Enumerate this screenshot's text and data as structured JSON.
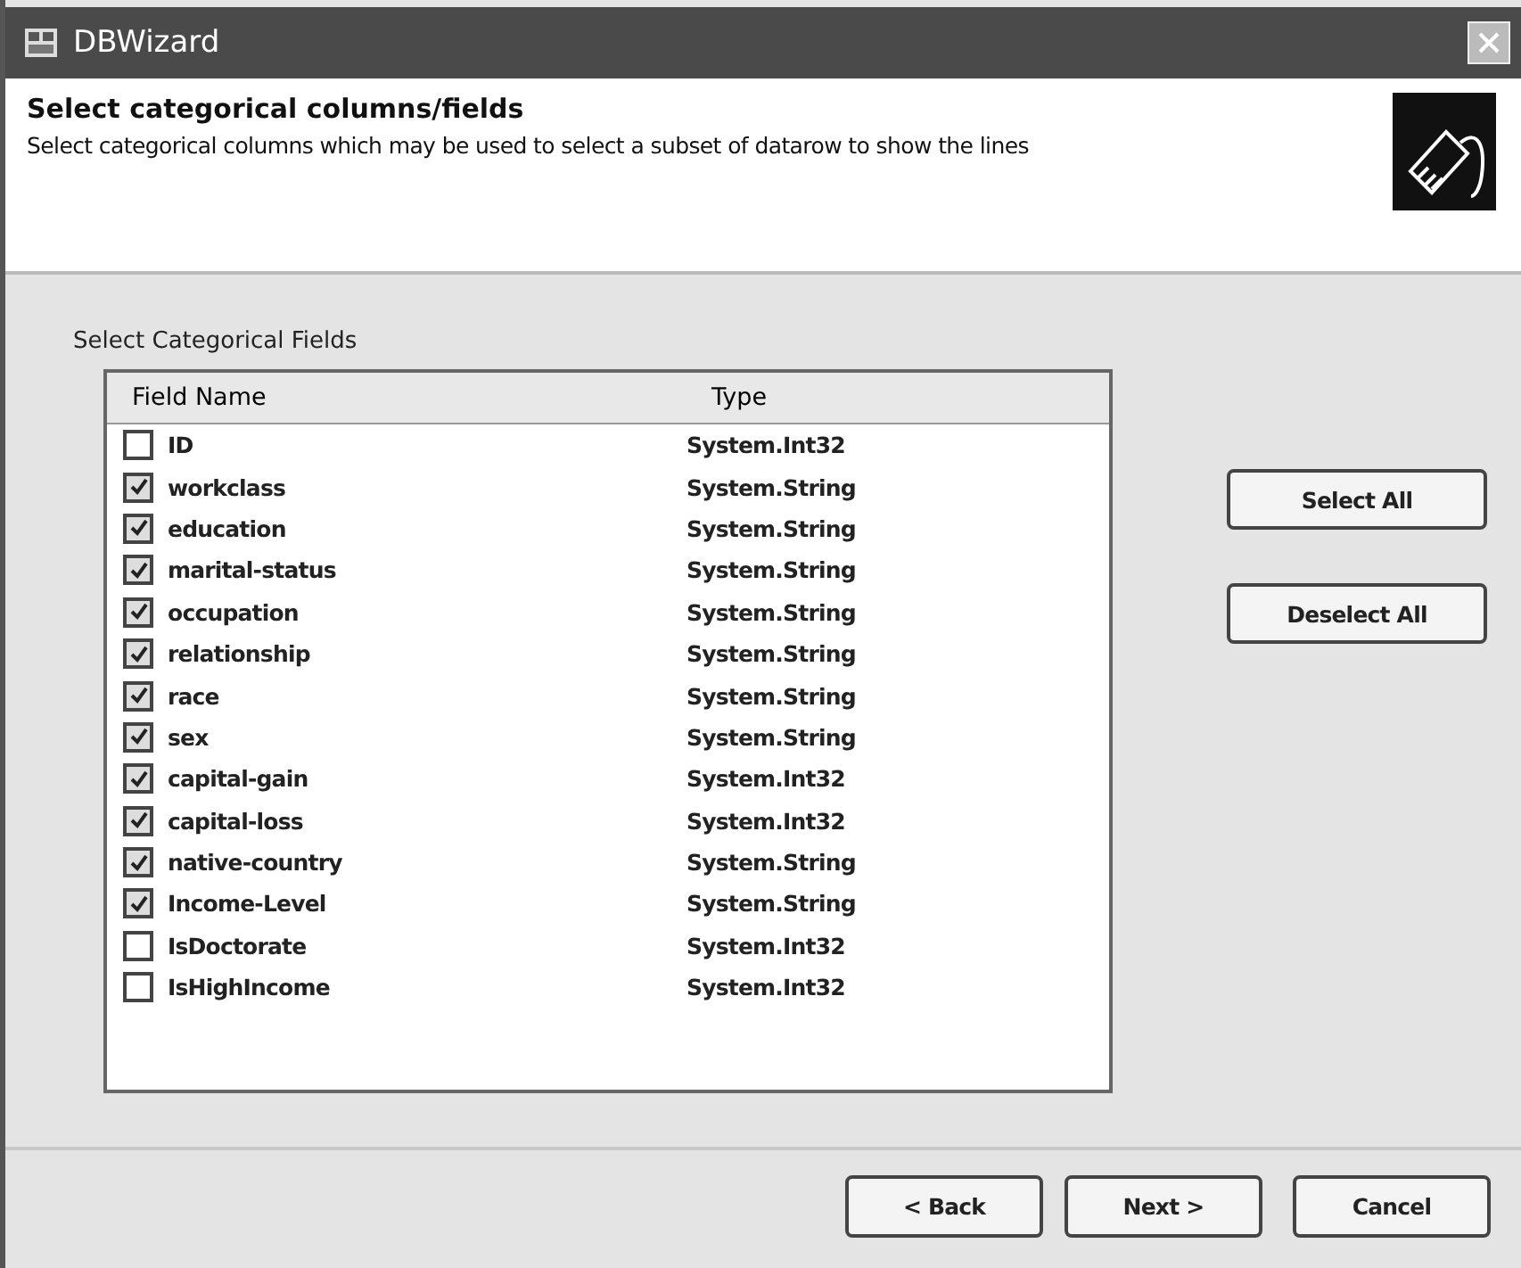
{
  "window": {
    "title": "DBWizard"
  },
  "header": {
    "title": "Select categorical columns/fields",
    "description": "Select categorical columns which may be used to select a subset of datarow to show the lines"
  },
  "group_label": "Select Categorical Fields",
  "table": {
    "columns": [
      "Field Name",
      "Type"
    ],
    "rows": [
      {
        "name": "ID",
        "type": "System.Int32",
        "checked": false
      },
      {
        "name": "workclass",
        "type": "System.String",
        "checked": true
      },
      {
        "name": "education",
        "type": "System.String",
        "checked": true
      },
      {
        "name": "marital-status",
        "type": "System.String",
        "checked": true
      },
      {
        "name": "occupation",
        "type": "System.String",
        "checked": true
      },
      {
        "name": "relationship",
        "type": "System.String",
        "checked": true
      },
      {
        "name": "race",
        "type": "System.String",
        "checked": true
      },
      {
        "name": "sex",
        "type": "System.String",
        "checked": true
      },
      {
        "name": "capital-gain",
        "type": "System.Int32",
        "checked": true
      },
      {
        "name": "capital-loss",
        "type": "System.Int32",
        "checked": true
      },
      {
        "name": "native-country",
        "type": "System.String",
        "checked": true
      },
      {
        "name": "Income-Level",
        "type": "System.String",
        "checked": true
      },
      {
        "name": "IsDoctorate",
        "type": "System.Int32",
        "checked": false
      },
      {
        "name": "IsHighIncome",
        "type": "System.Int32",
        "checked": false
      }
    ]
  },
  "side_buttons": [
    "Select All",
    "Deselect All"
  ],
  "footer_buttons": [
    "< Back",
    "Next >",
    "Cancel"
  ]
}
